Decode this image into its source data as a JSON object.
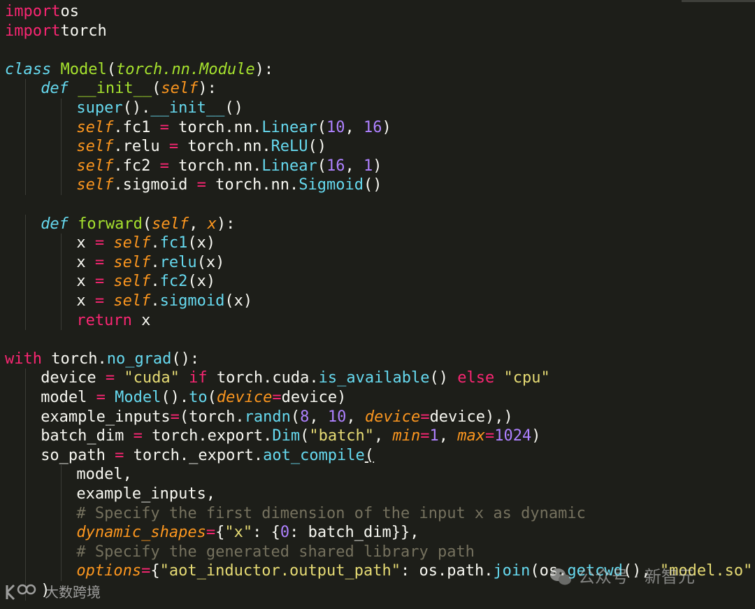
{
  "editor": {
    "lines": [
      [
        [
          "kw",
          "import"
        ],
        [
          "",
          "os"
        ]
      ],
      [
        [
          "kw",
          "import"
        ],
        [
          "",
          "torch"
        ]
      ],
      [],
      [
        [
          "dk",
          "class"
        ],
        [
          "",
          " "
        ],
        [
          "cls",
          "Model"
        ],
        [
          "",
          "("
        ],
        [
          "inh",
          "torch.nn.Module"
        ],
        [
          "",
          "):"
        ]
      ],
      [
        [
          "",
          ""
        ],
        [
          "dk",
          "def"
        ],
        [
          "",
          " "
        ],
        [
          "fn",
          "__init__"
        ],
        [
          "",
          "("
        ],
        [
          "par",
          "self"
        ],
        [
          "",
          "):"
        ]
      ],
      [
        [
          "bi",
          "super"
        ],
        [
          "",
          "()."
        ],
        [
          "bi",
          "__init__"
        ],
        [
          "",
          "()"
        ]
      ],
      [
        [
          "par",
          "self"
        ],
        [
          "",
          ".fc1 "
        ],
        [
          "op",
          "="
        ],
        [
          "",
          " torch.nn."
        ],
        [
          "cl",
          "Linear"
        ],
        [
          "",
          "("
        ],
        [
          "num",
          "10"
        ],
        [
          "",
          ", "
        ],
        [
          "num",
          "16"
        ],
        [
          "",
          ")"
        ]
      ],
      [
        [
          "par",
          "self"
        ],
        [
          "",
          ".relu "
        ],
        [
          "op",
          "="
        ],
        [
          "",
          " torch.nn."
        ],
        [
          "cl",
          "ReLU"
        ],
        [
          "",
          "()"
        ]
      ],
      [
        [
          "par",
          "self"
        ],
        [
          "",
          ".fc2 "
        ],
        [
          "op",
          "="
        ],
        [
          "",
          " torch.nn."
        ],
        [
          "cl",
          "Linear"
        ],
        [
          "",
          "("
        ],
        [
          "num",
          "16"
        ],
        [
          "",
          ", "
        ],
        [
          "num",
          "1"
        ],
        [
          "",
          ")"
        ]
      ],
      [
        [
          "par",
          "self"
        ],
        [
          "",
          ".sigmoid "
        ],
        [
          "op",
          "="
        ],
        [
          "",
          " torch.nn."
        ],
        [
          "cl",
          "Sigmoid"
        ],
        [
          "",
          "()"
        ]
      ],
      [],
      [
        [
          "dk",
          "def"
        ],
        [
          "",
          " "
        ],
        [
          "fn",
          "forward"
        ],
        [
          "",
          "("
        ],
        [
          "par",
          "self"
        ],
        [
          "",
          ", "
        ],
        [
          "par",
          "x"
        ],
        [
          "",
          "):"
        ]
      ],
      [
        [
          "",
          "x "
        ],
        [
          "op",
          "="
        ],
        [
          "",
          " "
        ],
        [
          "par",
          "self"
        ],
        [
          "",
          "."
        ],
        [
          "bi",
          "fc1"
        ],
        [
          "",
          "(x)"
        ]
      ],
      [
        [
          "",
          "x "
        ],
        [
          "op",
          "="
        ],
        [
          "",
          " "
        ],
        [
          "par",
          "self"
        ],
        [
          "",
          "."
        ],
        [
          "bi",
          "relu"
        ],
        [
          "",
          "(x)"
        ]
      ],
      [
        [
          "",
          "x "
        ],
        [
          "op",
          "="
        ],
        [
          "",
          " "
        ],
        [
          "par",
          "self"
        ],
        [
          "",
          "."
        ],
        [
          "bi",
          "fc2"
        ],
        [
          "",
          "(x)"
        ]
      ],
      [
        [
          "",
          "x "
        ],
        [
          "op",
          "="
        ],
        [
          "",
          " "
        ],
        [
          "par",
          "self"
        ],
        [
          "",
          "."
        ],
        [
          "bi",
          "sigmoid"
        ],
        [
          "",
          "(x)"
        ]
      ],
      [
        [
          "kw",
          "return"
        ],
        [
          "",
          " x"
        ]
      ],
      [],
      [
        [
          "kw",
          "with"
        ],
        [
          "",
          " torch."
        ],
        [
          "bi",
          "no_grad"
        ],
        [
          "",
          "():"
        ]
      ],
      [
        [
          "",
          "device "
        ],
        [
          "op",
          "="
        ],
        [
          "",
          " "
        ],
        [
          "str",
          "\"cuda\""
        ],
        [
          "",
          " "
        ],
        [
          "kw",
          "if"
        ],
        [
          "",
          " torch.cuda."
        ],
        [
          "bi",
          "is_available"
        ],
        [
          "",
          "() "
        ],
        [
          "kw",
          "else"
        ],
        [
          "",
          " "
        ],
        [
          "str",
          "\"cpu\""
        ]
      ],
      [
        [
          "",
          "model "
        ],
        [
          "op",
          "="
        ],
        [
          "",
          " "
        ],
        [
          "cl",
          "Model"
        ],
        [
          "",
          "()."
        ],
        [
          "bi",
          "to"
        ],
        [
          "",
          "("
        ],
        [
          "par",
          "device"
        ],
        [
          "op",
          "="
        ],
        [
          "",
          "device)"
        ]
      ],
      [
        [
          "",
          "example_inputs"
        ],
        [
          "op",
          "="
        ],
        [
          "",
          "(torch."
        ],
        [
          "bi",
          "randn"
        ],
        [
          "",
          "("
        ],
        [
          "num",
          "8"
        ],
        [
          "",
          ", "
        ],
        [
          "num",
          "10"
        ],
        [
          "",
          ", "
        ],
        [
          "par",
          "device"
        ],
        [
          "op",
          "="
        ],
        [
          "",
          "device),)"
        ]
      ],
      [
        [
          "",
          "batch_dim "
        ],
        [
          "op",
          "="
        ],
        [
          "",
          " torch.export."
        ],
        [
          "cl",
          "Dim"
        ],
        [
          "",
          "("
        ],
        [
          "str",
          "\"batch\""
        ],
        [
          "",
          ", "
        ],
        [
          "par",
          "min"
        ],
        [
          "op",
          "="
        ],
        [
          "num",
          "1"
        ],
        [
          "",
          ", "
        ],
        [
          "par",
          "max"
        ],
        [
          "op",
          "="
        ],
        [
          "num",
          "1024"
        ],
        [
          "",
          ")"
        ]
      ],
      [
        [
          "",
          "so_path "
        ],
        [
          "op",
          "="
        ],
        [
          "",
          " torch._export."
        ],
        [
          "bi",
          "aot_compile"
        ],
        [
          "ul",
          "("
        ]
      ],
      [
        [
          "",
          "model,"
        ]
      ],
      [
        [
          "",
          "example_inputs,"
        ]
      ],
      [
        [
          "cm",
          "# Specify the first dimension of the input x as dynamic"
        ]
      ],
      [
        [
          "par",
          "dynamic_shapes"
        ],
        [
          "op",
          "="
        ],
        [
          "",
          "{"
        ],
        [
          "str",
          "\"x\""
        ],
        [
          "",
          ": {"
        ],
        [
          "num",
          "0"
        ],
        [
          "",
          ": batch_dim}},"
        ]
      ],
      [
        [
          "cm",
          "# Specify the generated shared library path"
        ]
      ],
      [
        [
          "par",
          "options"
        ],
        [
          "op",
          "="
        ],
        [
          "",
          "{"
        ],
        [
          "str",
          "\"aot_inductor.output_path\""
        ],
        [
          "",
          ": os.path."
        ],
        [
          "bi",
          "join"
        ],
        [
          "",
          "(os."
        ],
        [
          "bi",
          "getcwd"
        ],
        [
          "",
          "(), "
        ],
        [
          "str",
          "\"model.so\""
        ],
        [
          "",
          ")},"
        ]
      ],
      [
        [
          "",
          ")"
        ]
      ]
    ]
  },
  "watermarks": {
    "left": "大数跨境",
    "right": "公众号 · 新智元"
  }
}
